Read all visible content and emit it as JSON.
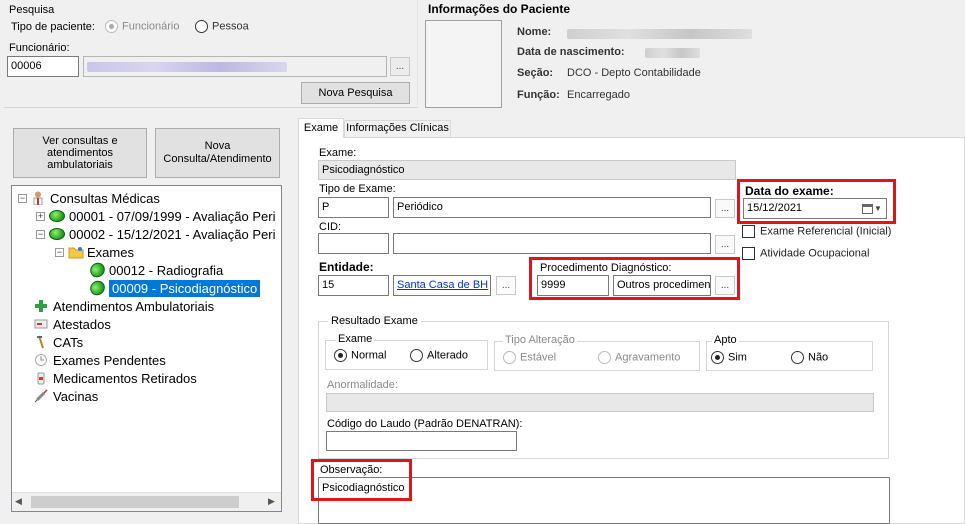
{
  "pesquisa": {
    "group_title": "Pesquisa",
    "tipo_label": "Tipo de paciente:",
    "opt_funcionario": "Funcionário",
    "opt_pessoa": "Pessoa",
    "funcionario_label": "Funcionário:",
    "funcionario_code": "00006",
    "ellipsis": "...",
    "nova_pesquisa": "Nova Pesquisa"
  },
  "paciente": {
    "title": "Informações do Paciente",
    "nome_label": "Nome:",
    "nasc_label": "Data de nascimento:",
    "secao_label": "Seção:",
    "secao_value": "DCO - Depto Contabilidade",
    "funcao_label": "Função:",
    "funcao_value": "Encarregado"
  },
  "buttons": {
    "ver_consultas": "Ver consultas e atendimentos ambulatoriais",
    "nova_consulta": "Nova Consulta/Atendimento"
  },
  "tree": {
    "root": "Consultas Médicas",
    "c1": "00001 - 07/09/1999 - Avaliação Peri",
    "c2": "00002 - 15/12/2021 - Avaliação Peri",
    "exames": "Exames",
    "e1": "00012 - Radiografia",
    "e2": "00009 - Psicodiagnóstico",
    "atend": "Atendimentos Ambulatoriais",
    "atestados": "Atestados",
    "cats": "CATs",
    "pendentes": "Exames Pendentes",
    "medicamentos": "Medicamentos Retirados",
    "vacinas": "Vacinas"
  },
  "tabs": {
    "exame": "Exame",
    "info": "Informações Clínicas"
  },
  "form": {
    "exame_label": "Exame:",
    "exame_value": "Psicodiagnóstico",
    "tipo_label": "Tipo de Exame:",
    "tipo_code": "P",
    "tipo_value": "Periódico",
    "cid_label": "CID:",
    "entidade_label": "Entidade:",
    "entidade_code": "15",
    "entidade_value": "Santa Casa de BH",
    "data_label": "Data do exame:",
    "data_value": "15/12/2021",
    "ref_label": "Exame Referencial (Inicial)",
    "ativ_label": "Atividade Ocupacional",
    "proc_label": "Procedimento Diagnóstico:",
    "proc_code": "9999",
    "proc_value": "Outros procedimentos",
    "ellipsis": "..."
  },
  "resultado": {
    "title": "Resultado Exame",
    "exame_group": "Exame",
    "normal": "Normal",
    "alterado": "Alterado",
    "tipo_alt_group": "Tipo Alteração",
    "estavel": "Estável",
    "agravamento": "Agravamento",
    "apto_group": "Apto",
    "sim": "Sim",
    "nao": "Não",
    "anormalidade_label": "Anormalidade:",
    "laudo_label": "Código do Laudo (Padrão DENATRAN):",
    "obs_label": "Observação:",
    "obs_value": "Psicodiagnóstico"
  },
  "colors": {
    "highlight": "#e0151a",
    "selection": "#0078d7",
    "link": "#0033cc"
  }
}
